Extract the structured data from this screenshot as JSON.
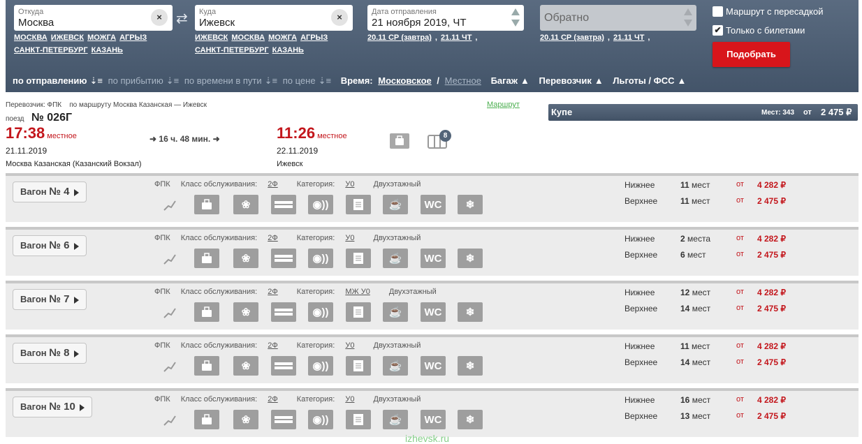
{
  "search": {
    "from": {
      "label": "Откуда",
      "value": "Москва"
    },
    "to": {
      "label": "Куда",
      "value": "Ижевск"
    },
    "date": {
      "label": "Дата отправления",
      "value": "21 ноября 2019, ЧТ"
    },
    "return": {
      "placeholder": "Обратно"
    },
    "from_quick": [
      "МОСКВА",
      "ИЖЕВСК",
      "МОЖГА",
      "АГРЫЗ",
      "САНКТ-ПЕТЕРБУРГ",
      "КАЗАНЬ"
    ],
    "to_quick": [
      "ИЖЕВСК",
      "МОСКВА",
      "МОЖГА",
      "АГРЫЗ",
      "САНКТ-ПЕТЕРБУРГ",
      "КАЗАНЬ"
    ],
    "date_quick": [
      "20.11 СР (завтра)",
      "21.11 ЧТ"
    ],
    "return_quick": [
      "20.11 СР (завтра)",
      "21.11 ЧТ"
    ],
    "opt_transfer": "Маршрут с пересадкой",
    "opt_tickets": "Только с билетами",
    "submit": "Подобрать"
  },
  "sortbar": {
    "by_departure": "по отправлению",
    "by_arrival": "по прибытию",
    "by_duration": "по времени в пути",
    "by_price": "по цене",
    "time_label": "Время:",
    "moscow": "Московское",
    "slash": "/",
    "local": "Местное",
    "baggage": "Багаж",
    "carrier": "Перевозчик",
    "benefits": "Льготы / ФСС"
  },
  "train": {
    "carrier_line": "Перевозчик: ФПК",
    "route_line": "по маршруту Москва Казанская — Ижевск",
    "route_link": "Маршрут",
    "train_word": "поезд",
    "number": "№ 026Г",
    "dep_time": "17:38",
    "dep_local": "местное",
    "dep_date": "21.11.2019",
    "dep_station": "Москва Казанская (Казанский Вокзал)",
    "duration": "16 ч. 48 мин.",
    "arr_time": "11:26",
    "arr_local": "местное",
    "arr_date": "22.11.2019",
    "arr_station": "Ижевск",
    "badge": "8"
  },
  "coupe": {
    "title": "Купе",
    "seats": "Мест: 343",
    "from": "от",
    "price": "2 475 ₽"
  },
  "wagons": [
    {
      "label": "Вагон",
      "num": "№ 4",
      "carrier": "ФПК",
      "class_label": "Класс обслуживания:",
      "class_val": "2Ф",
      "cat_label": "Категория:",
      "cat_val": "У0",
      "deck": "Двухэтажный",
      "lower": "Нижнее",
      "lower_count": "11",
      "lower_unit": "мест",
      "lower_price": "4 282 ₽",
      "upper": "Верхнее",
      "upper_count": "11",
      "upper_unit": "мест",
      "upper_price": "2 475 ₽",
      "ot": "от"
    },
    {
      "label": "Вагон",
      "num": "№ 6",
      "carrier": "ФПК",
      "class_label": "Класс обслуживания:",
      "class_val": "2Ф",
      "cat_label": "Категория:",
      "cat_val": "У0",
      "deck": "Двухэтажный",
      "lower": "Нижнее",
      "lower_count": "2",
      "lower_unit": "места",
      "lower_price": "4 282 ₽",
      "upper": "Верхнее",
      "upper_count": "6",
      "upper_unit": "мест",
      "upper_price": "2 475 ₽",
      "ot": "от"
    },
    {
      "label": "Вагон",
      "num": "№ 7",
      "carrier": "ФПК",
      "class_label": "Класс обслуживания:",
      "class_val": "2Ф",
      "cat_label": "Категория:",
      "cat_val": "МЖ У0",
      "deck": "Двухэтажный",
      "lower": "Нижнее",
      "lower_count": "12",
      "lower_unit": "мест",
      "lower_price": "4 282 ₽",
      "upper": "Верхнее",
      "upper_count": "14",
      "upper_unit": "мест",
      "upper_price": "2 475 ₽",
      "ot": "от"
    },
    {
      "label": "Вагон",
      "num": "№ 8",
      "carrier": "ФПК",
      "class_label": "Класс обслуживания:",
      "class_val": "2Ф",
      "cat_label": "Категория:",
      "cat_val": "У0",
      "deck": "Двухэтажный",
      "lower": "Нижнее",
      "lower_count": "11",
      "lower_unit": "мест",
      "lower_price": "4 282 ₽",
      "upper": "Верхнее",
      "upper_count": "14",
      "upper_unit": "мест",
      "upper_price": "2 475 ₽",
      "ot": "от"
    },
    {
      "label": "Вагон",
      "num": "№ 10",
      "carrier": "ФПК",
      "class_label": "Класс обслуживания:",
      "class_val": "2Ф",
      "cat_label": "Категория:",
      "cat_val": "У0",
      "deck": "Двухэтажный",
      "lower": "Нижнее",
      "lower_count": "16",
      "lower_unit": "мест",
      "lower_price": "4 282 ₽",
      "upper": "Верхнее",
      "upper_count": "13",
      "upper_unit": "мест",
      "upper_price": "2 475 ₽",
      "ot": "от"
    }
  ],
  "service_icons": [
    "chart-icon",
    "bag-icon",
    "pet-icon",
    "bed-linen-icon",
    "radio-icon",
    "newspaper-icon",
    "food-icon",
    "wc-icon",
    "snowflake-icon"
  ],
  "watermark": "izhevsk.ru"
}
